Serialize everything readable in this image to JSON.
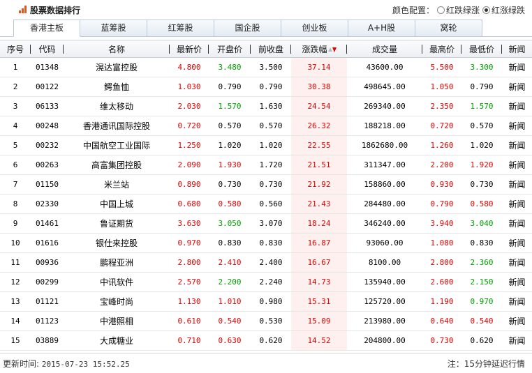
{
  "header": {
    "title": "股票数据排行",
    "color_config_label": "颜色配置：",
    "option_red_fall": "红跌绿涨",
    "option_red_rise": "红涨绿跌",
    "selected_option": "红涨绿跌"
  },
  "tabs": [
    {
      "label": "香港主板",
      "active": true
    },
    {
      "label": "蓝筹股",
      "active": false
    },
    {
      "label": "红筹股",
      "active": false
    },
    {
      "label": "国企股",
      "active": false
    },
    {
      "label": "创业板",
      "active": false
    },
    {
      "label": "A+H股",
      "active": false
    },
    {
      "label": "窝轮",
      "active": false
    }
  ],
  "table": {
    "headers": [
      "序号",
      "代码",
      "名称",
      "最新价",
      "开盘价",
      "前收盘",
      "涨跌幅",
      "成交量",
      "最高价",
      "最低价",
      "新闻"
    ],
    "sorted_column": "涨跌幅",
    "sort_direction": "desc",
    "rows": [
      {
        "no": "1",
        "code": "01348",
        "name": "滉达富控股",
        "last": "4.800",
        "open": "3.480",
        "prev": "3.500",
        "chg": "37.14",
        "vol": "43600.00",
        "high": "5.500",
        "low": "3.300",
        "news": "新闻"
      },
      {
        "no": "2",
        "code": "00122",
        "name": "鳄鱼恤",
        "last": "1.030",
        "open": "0.790",
        "prev": "0.790",
        "chg": "30.38",
        "vol": "498645.00",
        "high": "1.050",
        "low": "0.790",
        "news": "新闻"
      },
      {
        "no": "3",
        "code": "06133",
        "name": "维太移动",
        "last": "2.030",
        "open": "1.570",
        "prev": "1.630",
        "chg": "24.54",
        "vol": "269340.00",
        "high": "2.350",
        "low": "1.570",
        "news": "新闻"
      },
      {
        "no": "4",
        "code": "00248",
        "name": "香港通讯国际控股",
        "last": "0.720",
        "open": "0.570",
        "prev": "0.570",
        "chg": "26.32",
        "vol": "188218.00",
        "high": "0.720",
        "low": "0.570",
        "news": "新闻"
      },
      {
        "no": "5",
        "code": "00232",
        "name": "中国航空工业国际",
        "last": "1.250",
        "open": "1.020",
        "prev": "1.020",
        "chg": "22.55",
        "vol": "1862680.00",
        "high": "1.260",
        "low": "1.020",
        "news": "新闻"
      },
      {
        "no": "6",
        "code": "00263",
        "name": "高富集团控股",
        "last": "2.090",
        "open": "1.930",
        "prev": "1.720",
        "chg": "21.51",
        "vol": "311347.00",
        "high": "2.200",
        "low": "1.920",
        "news": "新闻"
      },
      {
        "no": "7",
        "code": "01150",
        "name": "米兰站",
        "last": "0.890",
        "open": "0.730",
        "prev": "0.730",
        "chg": "21.92",
        "vol": "158860.00",
        "high": "0.930",
        "low": "0.730",
        "news": "新闻"
      },
      {
        "no": "8",
        "code": "02330",
        "name": "中国上城",
        "last": "0.680",
        "open": "0.580",
        "prev": "0.560",
        "chg": "21.43",
        "vol": "284480.00",
        "high": "0.790",
        "low": "0.580",
        "news": "新闻"
      },
      {
        "no": "9",
        "code": "01461",
        "name": "鲁证期货",
        "last": "3.630",
        "open": "3.050",
        "prev": "3.070",
        "chg": "18.24",
        "vol": "346240.00",
        "high": "3.940",
        "low": "3.040",
        "news": "新闻"
      },
      {
        "no": "10",
        "code": "01616",
        "name": "银仕来控股",
        "last": "0.970",
        "open": "0.830",
        "prev": "0.830",
        "chg": "16.87",
        "vol": "93060.00",
        "high": "1.080",
        "low": "0.830",
        "news": "新闻"
      },
      {
        "no": "11",
        "code": "00936",
        "name": "鹏程亚洲",
        "last": "2.800",
        "open": "2.410",
        "prev": "2.400",
        "chg": "16.67",
        "vol": "8100.00",
        "high": "2.800",
        "low": "2.360",
        "news": "新闻"
      },
      {
        "no": "12",
        "code": "00299",
        "name": "中讯软件",
        "last": "2.570",
        "open": "2.200",
        "prev": "2.240",
        "chg": "14.73",
        "vol": "135940.00",
        "high": "2.600",
        "low": "2.150",
        "news": "新闻"
      },
      {
        "no": "13",
        "code": "01121",
        "name": "宝峰时尚",
        "last": "1.130",
        "open": "1.010",
        "prev": "0.980",
        "chg": "15.31",
        "vol": "125720.00",
        "high": "1.190",
        "low": "0.970",
        "news": "新闻"
      },
      {
        "no": "14",
        "code": "01123",
        "name": "中港照相",
        "last": "0.610",
        "open": "0.540",
        "prev": "0.530",
        "chg": "15.09",
        "vol": "213980.00",
        "high": "0.640",
        "low": "0.540",
        "news": "新闻"
      },
      {
        "no": "15",
        "code": "03889",
        "name": "大成糖业",
        "last": "0.710",
        "open": "0.630",
        "prev": "0.620",
        "chg": "14.52",
        "vol": "204800.00",
        "high": "0.730",
        "low": "0.620",
        "news": "新闻"
      }
    ]
  },
  "footer": {
    "update_label": "更新时间:",
    "update_time": "2015-07-23 15:52.25",
    "delay_note": "注：15分钟延迟行情"
  },
  "colors": {
    "up": "#e60000",
    "down": "#00a000",
    "accent": "#e8531c",
    "chg_bg": "#fdf0ee"
  }
}
